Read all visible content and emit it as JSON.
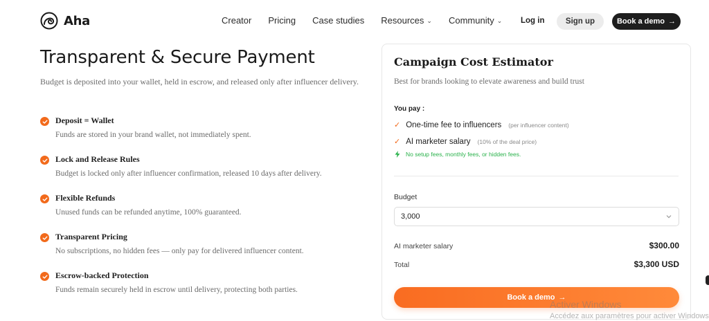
{
  "brand": {
    "name": "Aha"
  },
  "nav": {
    "items": [
      {
        "label": "Creator",
        "dropdown": false
      },
      {
        "label": "Pricing",
        "dropdown": false
      },
      {
        "label": "Case studies",
        "dropdown": false
      },
      {
        "label": "Resources",
        "dropdown": true
      },
      {
        "label": "Community",
        "dropdown": true
      }
    ],
    "login": "Log in",
    "signup": "Sign up",
    "book_demo": "Book a demo",
    "arrow": "→"
  },
  "hero": {
    "title": "Transparent & Secure Payment",
    "subtitle": "Budget is deposited into your wallet, held in escrow, and released only after influencer delivery."
  },
  "features": [
    {
      "title": "Deposit = Wallet",
      "desc": "Funds are stored in your brand wallet, not immediately spent."
    },
    {
      "title": "Lock and Release Rules",
      "desc": "Budget is locked only after influencer confirmation, released 10 days after delivery."
    },
    {
      "title": "Flexible Refunds",
      "desc": "Unused funds can be refunded anytime, 100% guaranteed."
    },
    {
      "title": "Transparent Pricing",
      "desc": "No subscriptions, no hidden fees — only pay for delivered influencer content."
    },
    {
      "title": "Escrow-backed Protection",
      "desc": "Funds remain securely held in escrow until delivery, protecting both parties."
    }
  ],
  "estimator": {
    "title": "Campaign Cost Estimator",
    "subtitle": "Best for brands looking to elevate awareness and build trust",
    "you_pay": "You pay :",
    "items": [
      {
        "label": "One-time fee to influencers",
        "note": "(per influencer content)"
      },
      {
        "label": "AI marketer salary",
        "note": "(10% of the deal price)"
      }
    ],
    "no_fees": "No setup fees, monthly fees, or hidden fees.",
    "budget_label": "Budget",
    "budget_value": "3,000",
    "salary_label": "AI marketer salary",
    "salary_value": "$300.00",
    "total_label": "Total",
    "total_value": "$3,300 USD",
    "cta": "Book a demo",
    "cta_arrow": "→"
  },
  "watermark": {
    "line1": "Activer Windows",
    "line2": "Accédez aux paramètres pour activer Windows."
  },
  "colors": {
    "accent": "#f26a1b",
    "success": "#2bb24c",
    "dark": "#1e1e1e"
  }
}
